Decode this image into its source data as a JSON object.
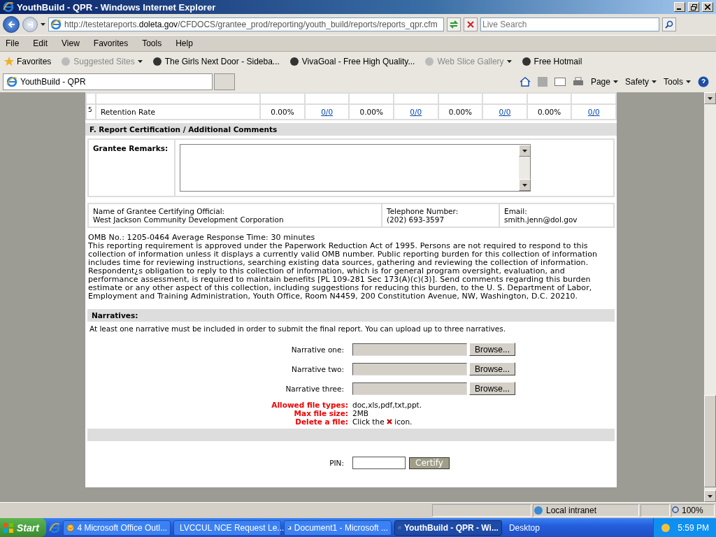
{
  "browser": {
    "title": "YouthBuild - QPR - Windows Internet Explorer",
    "address_prefix": "http://testetareports.",
    "address_domain": "doleta.gov",
    "address_path": "/CFDOCS/grantee_prod/reporting/youth_build/reports/reports_qpr.cfm",
    "search_placeholder": "Live Search",
    "menu": [
      "File",
      "Edit",
      "View",
      "Favorites",
      "Tools",
      "Help"
    ],
    "favorites_label": "Favorites",
    "favorites": [
      {
        "label": "Suggested Sites",
        "disabled": true
      },
      {
        "label": "The Girls Next Door - Sideba...",
        "disabled": false
      },
      {
        "label": "VivaGoal - Free High Quality...",
        "disabled": false
      },
      {
        "label": "Web Slice Gallery",
        "disabled": true
      },
      {
        "label": "Free Hotmail",
        "disabled": false
      }
    ],
    "tab": "YouthBuild - QPR",
    "commands": [
      "Page",
      "Safety",
      "Tools"
    ]
  },
  "outcome_row": {
    "number": "5",
    "name": "Retention Rate",
    "cells": [
      {
        "rate": "0.00%",
        "ratio": "0/0"
      },
      {
        "rate": "0.00%",
        "ratio": "0/0"
      },
      {
        "rate": "0.00%",
        "ratio": "0/0"
      },
      {
        "rate": "0.00%",
        "ratio": "0/0"
      }
    ]
  },
  "certification": {
    "heading": "F. Report Certification / Additional Comments",
    "remarks_label": "Grantee Remarks:",
    "official_label": "Name of Grantee Certifying Official:",
    "official_value": "West Jackson Community Development Corporation",
    "phone_label": "Telephone Number:",
    "phone_value": "(202) 693-3597",
    "email_label": "Email:",
    "email_value": "smith.jenn@dol.gov"
  },
  "omb": {
    "line": "OMB No.: 1205-0464 Average Response Time: 30 minutes",
    "paragraph": "This reporting requirement is approved under the Paperwork Reduction Act of 1995. Persons are not required to respond to this collection of information unless it displays a currently valid OMB number. Public reporting burden for this collection of information includes time for reviewing instructions, searching existing data sources, gathering and reviewing the collection of information. Respondent¿s obligation to reply to this collection of information, which is for general program oversight, evaluation, and performance assessment, is required to maintain benefits [PL 109-281 Sec 173(A)(c)(3)]. Send comments regarding this burden estimate or any other aspect of this collection, including suggestions for reducing this burden, to the U. S. Department of Labor, Employment and Training Administration, Youth Office, Room N4459, 200 Constitution Avenue, NW, Washington, D.C. 20210."
  },
  "narratives": {
    "heading": "Narratives:",
    "note": "At least one narrative must be included in order to submit the final report. You can upload up to three narratives.",
    "fields": [
      {
        "label": "Narrative one:",
        "button": "Browse..."
      },
      {
        "label": "Narrative two:",
        "button": "Browse..."
      },
      {
        "label": "Narrative three:",
        "button": "Browse..."
      }
    ],
    "rules": [
      {
        "label": "Allowed file types:",
        "value": "doc,xls,pdf,txt,ppt."
      },
      {
        "label": "Max file size:",
        "value": "2MB"
      }
    ],
    "delete_rule": {
      "label": "Delete a file:",
      "before": "Click the",
      "after": "icon."
    }
  },
  "pin": {
    "label": "PIN:",
    "button": "Certify"
  },
  "status_bar": {
    "zone": "Local intranet",
    "zoom": "100%"
  },
  "taskbar": {
    "start": "Start",
    "tasks": [
      {
        "label": "4 Microsoft Office Outl...",
        "selected": false,
        "kind": "outlook"
      },
      {
        "label": "LVCCUL NCE Request Le...",
        "selected": false,
        "kind": "word"
      },
      {
        "label": "Document1 - Microsoft ...",
        "selected": false,
        "kind": "word"
      },
      {
        "label": "YouthBuild - QPR - Wi...",
        "selected": true,
        "kind": "ie"
      }
    ],
    "desktop": "Desktop",
    "clock": "5:59 PM"
  }
}
